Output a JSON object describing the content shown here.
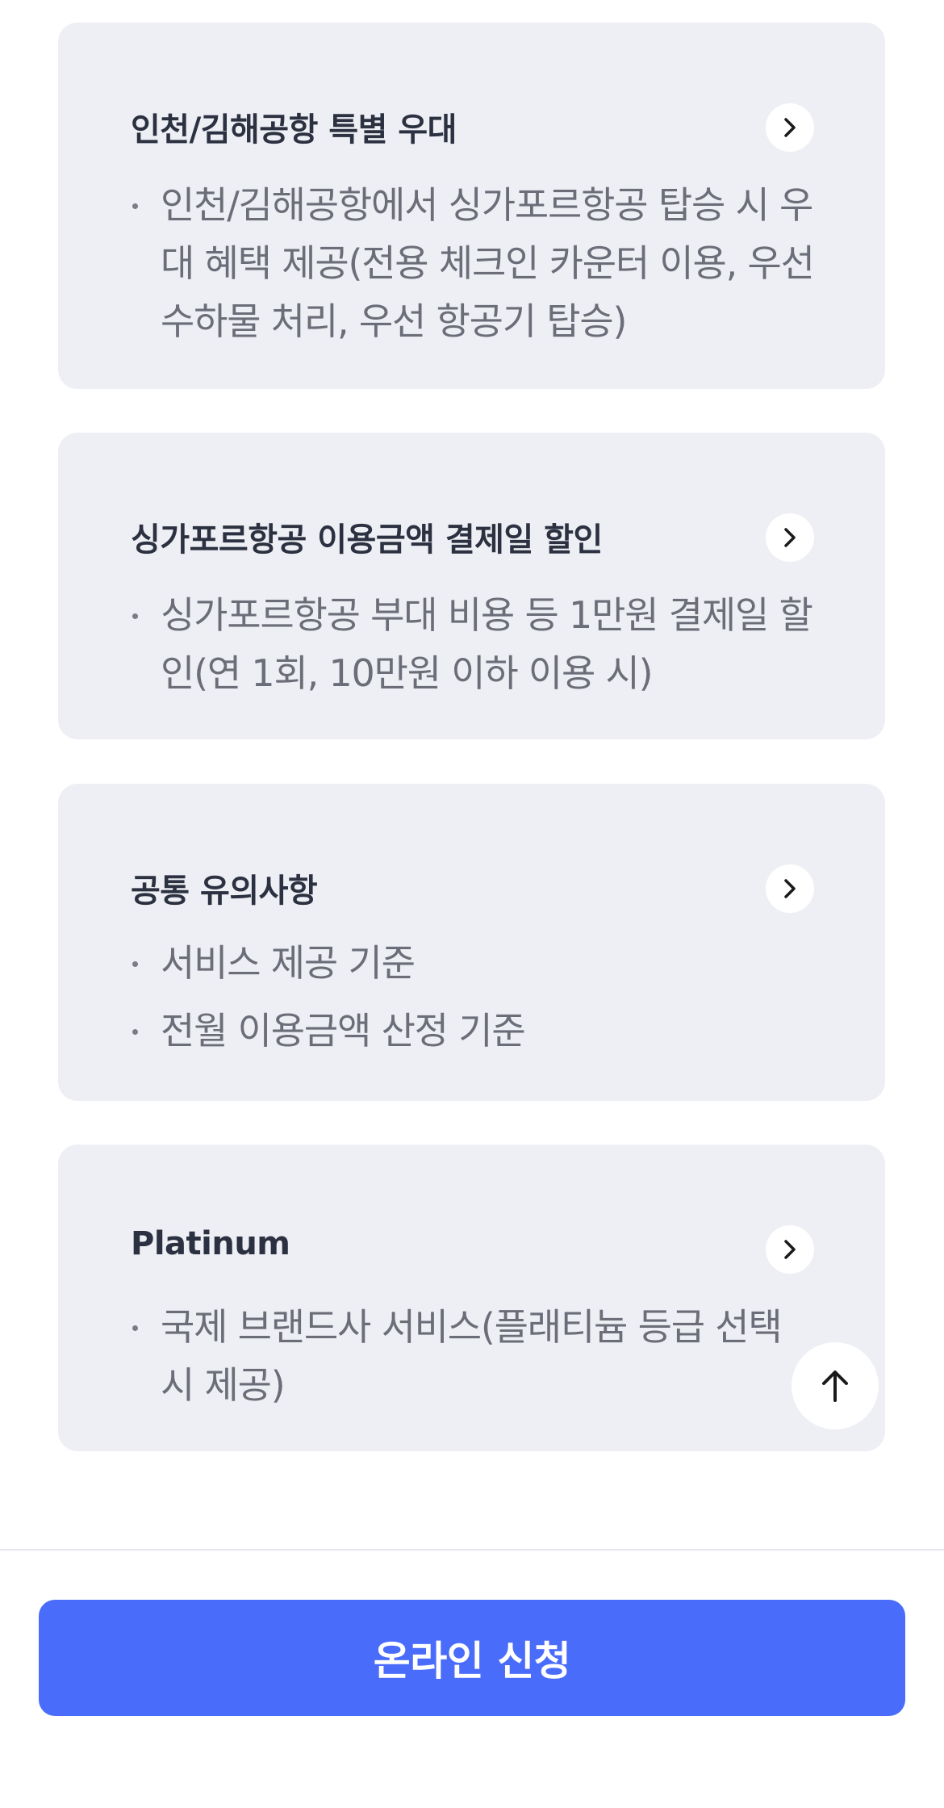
{
  "cards": [
    {
      "title": "인천/김해공항 특별 우대",
      "bullets": [
        "인천/김해공항에서 싱가포르항공 탑승 시 우대 혜택 제공(전용 체크인 카운터 이용, 우선 수하물 처리, 우선 항공기 탑승)"
      ]
    },
    {
      "title": "싱가포르항공 이용금액 결제일 할인",
      "bullets": [
        "싱가포르항공 부대 비용 등 1만원 결제일 할인(연 1회, 10만원 이하 이용 시)"
      ]
    },
    {
      "title": "공통 유의사항",
      "bullets": [
        "서비스 제공 기준",
        "전월 이용금액 산정 기준"
      ]
    },
    {
      "title": "Platinum",
      "bullets": [
        "국제 브랜드사 서비스(플래티늄 등급 선택 시 제공)"
      ]
    }
  ],
  "icons": {
    "card_action": "chevron-right-icon",
    "scroll_top": "arrow-up-icon"
  },
  "apply_button": {
    "label": "온라인 신청"
  },
  "colors": {
    "card_bg": "#eeeff4",
    "primary": "#4a6cfb",
    "title_text": "#2b3140",
    "body_text": "#6b6e78"
  }
}
